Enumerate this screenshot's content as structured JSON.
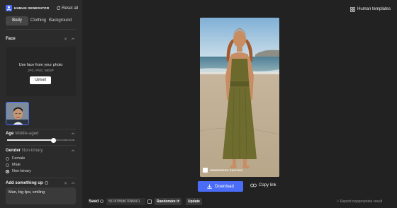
{
  "header": {
    "app_title": "HUMAN GENERATOR",
    "reset_label": "Reset all",
    "templates_label": "Human templates"
  },
  "tabs": [
    {
      "label": "Body",
      "active": true
    },
    {
      "label": "Clothing",
      "active": false
    },
    {
      "label": "Background",
      "active": false
    }
  ],
  "face": {
    "title": "Face",
    "upload_title": "Use face from your photo",
    "upload_formats": "JPG, PNG, WEBP",
    "upload_button": "Upload"
  },
  "age": {
    "title": "Age",
    "value": "Middle-aged",
    "slider_steps": 9,
    "slider_position": 0.69
  },
  "gender": {
    "title": "Gender",
    "value": "Non-binary",
    "options": [
      {
        "label": "Female",
        "selected": false
      },
      {
        "label": "Male",
        "selected": false
      },
      {
        "label": "Non-binary",
        "selected": true
      }
    ]
  },
  "add_something": {
    "title": "Add something up",
    "prompt": "Man, big lips, smiling"
  },
  "image": {
    "badge": "GENERATED PHOTOS"
  },
  "actions": {
    "download": "Download",
    "copy_link": "Copy link"
  },
  "footer": {
    "seed_label": "Seed",
    "seed_value": "5578785867096001",
    "randomize": "Randomize",
    "update": "Update",
    "report": "Report inappropriate result"
  },
  "colors": {
    "accent": "#4a6cf7",
    "background": "#222222",
    "sidebar": "#2b2b2b"
  }
}
